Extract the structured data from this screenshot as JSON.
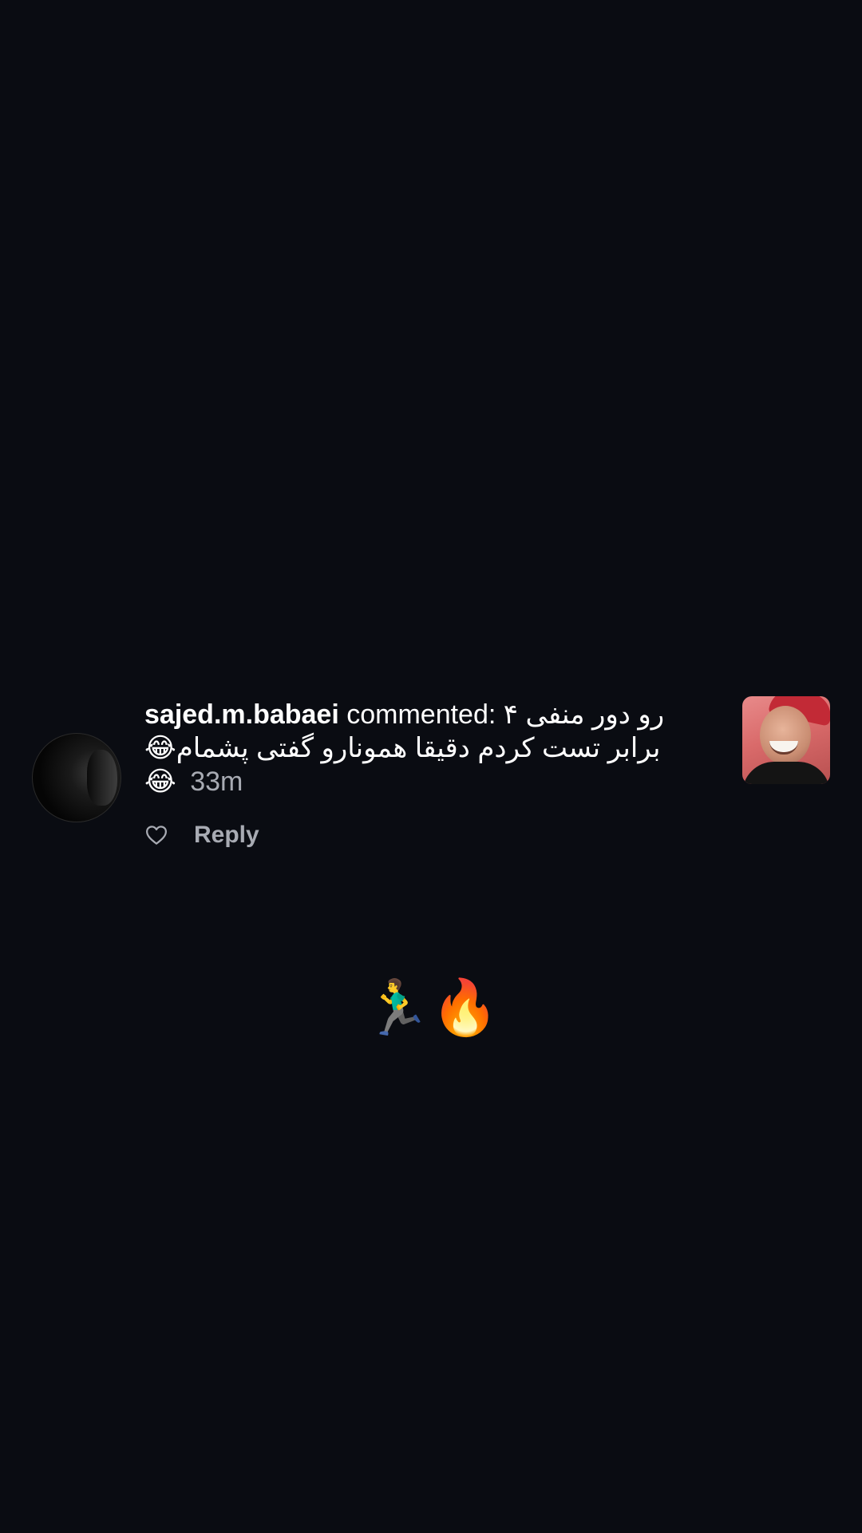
{
  "notification": {
    "username": "sajed.m.babaei",
    "action_text": "commented:",
    "comment_line1": "رو دور منفی ۴",
    "comment_line2": "برابر تست کردم دقیقا همونارو گفتی پشمام😂",
    "comment_tail_emoji": "😂",
    "timestamp": "33m",
    "reply_label": "Reply",
    "like_icon": "heart-outline-icon"
  },
  "caption": {
    "emojis": "🏃‍♂️🔥"
  },
  "colors": {
    "background": "#0a0c12",
    "text_primary": "#ffffff",
    "text_secondary": "#a8abb3"
  }
}
